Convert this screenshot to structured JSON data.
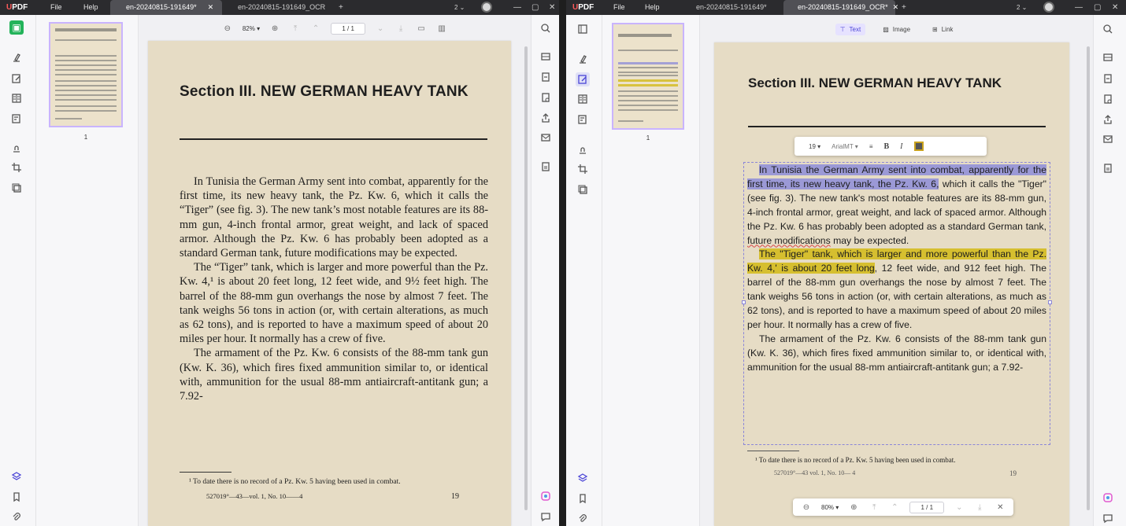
{
  "left_window": {
    "app_name": "UPDF",
    "menu": [
      "File",
      "Help"
    ],
    "tabs": [
      {
        "label": "en-20240815-191649*",
        "active": true,
        "closable": true
      },
      {
        "label": "en-20240815-191649_OCR",
        "active": false,
        "closable": false
      }
    ],
    "new_tab": "+",
    "window_count": "2 ⌄",
    "toolbar": {
      "zoom": "82%",
      "page": "1 / 1"
    },
    "thumbnail_page_number": "1",
    "document": {
      "title": "Section III. NEW GERMAN HEAVY TANK",
      "paragraphs": [
        "In Tunisia the German Army sent into combat, apparently for the first time, its new heavy tank, the Pz. Kw. 6, which it calls the “Tiger” (see fig. 3). The new tank’s most notable features are its 88-mm gun, 4-inch frontal armor, great weight, and lack of spaced armor. Although the Pz. Kw. 6 has probably been adopted as a standard German tank, future modifications may be expected.",
        "The “Tiger” tank, which is larger and more powerful than the Pz. Kw. 4,¹ is about 20 feet long, 12 feet wide, and 9½ feet high. The barrel of the 88-mm gun overhangs the nose by almost 7 feet. The tank weighs 56 tons in action (or, with certain alterations, as much as 62 tons), and is reported to have a maximum speed of about 20 miles per hour. It normally has a crew of five.",
        "The armament of the Pz. Kw. 6 consists of the 88-mm tank gun (Kw. K. 36), which fires fixed ammunition similar to, or identical with, ammunition for the usual 88-mm antiaircraft-antitank gun; a 7.92-"
      ],
      "footnote": "¹ To date there is no record of a Pz. Kw. 5 having been used in combat.",
      "imprint": "527019°—43—vol. 1, No. 10——4",
      "page_number": "19"
    }
  },
  "right_window": {
    "app_name": "UPDF",
    "menu": [
      "File",
      "Help"
    ],
    "tabs": [
      {
        "label": "en-20240815-191649*",
        "active": false,
        "closable": false
      },
      {
        "label": "en-20240815-191649_OCR*",
        "active": true,
        "closable": true
      }
    ],
    "new_tab": "+",
    "window_count": "2 ⌄",
    "edit_tabs": [
      "Text",
      "Image",
      "Link"
    ],
    "format_bar": {
      "font_size": "19",
      "font_name": "ArialMT",
      "bold": "B",
      "italic": "I"
    },
    "thumbnail_page_number": "1",
    "bottom_bar": {
      "zoom": "80%",
      "page": "1 / 1"
    },
    "document": {
      "title": "Section III. NEW GERMAN HEAVY TANK",
      "p1_selected": "In Tunisia the German Army sent into combat, apparently for the first time, its new heavy tank, the Pz. Kw. 6,",
      "p1_rest_a": " which it calls the \"Tiger\" (see fig. 3). The new tank's most notable features are its 88-mm gun, 4-inch frontal armor, great weight, and lack of spaced armor. Although the Pz. Kw. 6 has probably been adopted as a standard German tank, ",
      "p1_misspelled": "future modifications",
      "p1_rest_b": " may be expected.",
      "p2_highlight": "The \"Tiger\" tank, which is larger and more powerful than the Pz. Kw. 4,' is about 20 feet long",
      "p2_rest": ", 12 feet wide, and 912 feet high. The barrel of the 88-mm gun overhangs the nose by almost 7 feet. The tank weighs 56 tons in action (or, with certain alterations, as much as 62 tons), and is reported to have a maximum speed of about 20 miles per hour. It normally has a crew of five.",
      "p3": "The armament of the Pz. Kw. 6 consists of the 88-mm tank gun (Kw. K. 36), which fires fixed ammunition similar to, or identical with, ammunition for the usual 88-mm antiaircraft-antitank gun; a 7.92-",
      "footnote": "¹ To date there is no record of a Pz. Kw. 5 having been used in combat.",
      "imprint": "527019°—43 vol. 1, No. 10— 4",
      "page_number": "19"
    }
  },
  "colors": {
    "accent": "#4b45d6",
    "selection": "#9b99d6",
    "highlight": "#d6bf2f",
    "paper": "#e6dcc5",
    "titlebar": "#2b2b2e"
  }
}
